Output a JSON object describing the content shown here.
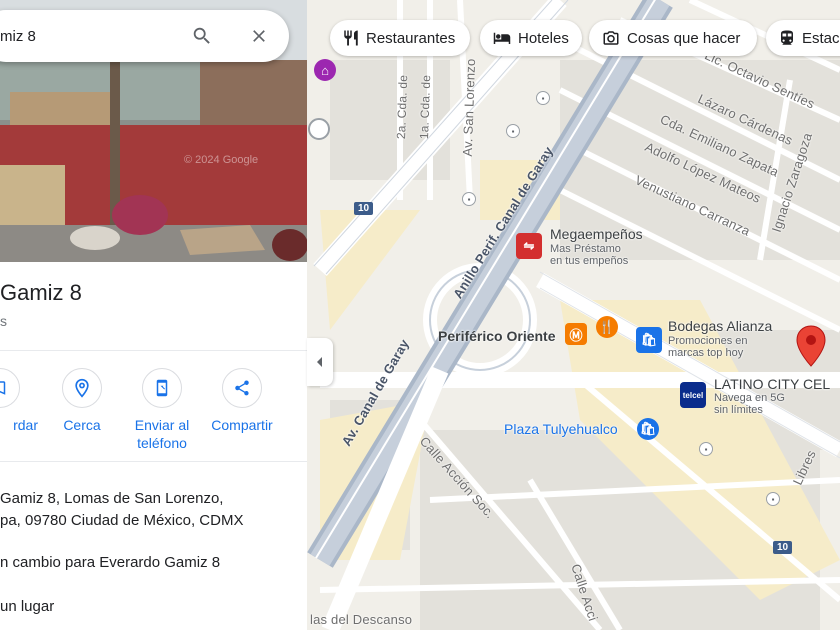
{
  "search": {
    "query": "miz 8"
  },
  "place": {
    "title": "Gamiz 8",
    "subtitle": "s",
    "address_line1": "Gamiz 8, Lomas de San Lorenzo,",
    "address_line2": "pa, 09780 Ciudad de México, CDMX",
    "suggest_edit": "n cambio para Everardo Gamiz 8",
    "add_place": "un lugar",
    "photo_watermark": "© 2024 Google"
  },
  "actions": [
    {
      "label": "rdar",
      "icon": "bookmark-icon"
    },
    {
      "label": "Cerca",
      "icon": "nearby-icon"
    },
    {
      "label": "Enviar al teléfono",
      "icon": "send-to-phone-icon"
    },
    {
      "label": "Compartir",
      "icon": "share-icon"
    }
  ],
  "chips": [
    {
      "label": "Restaurantes",
      "icon": "restaurant-icon"
    },
    {
      "label": "Hoteles",
      "icon": "hotel-icon"
    },
    {
      "label": "Cosas que hacer",
      "icon": "camera-icon"
    },
    {
      "label": "Estac",
      "icon": "transit-icon"
    }
  ],
  "map": {
    "streets": {
      "octavio": "Lic. Octavio Sentíes",
      "lazaro": "Lázaro Cárdenas",
      "emiliano": "Cda. Emiliano Zapata",
      "adolfo": "Adolfo López Mateos",
      "venustiano": "Venustiano Carranza",
      "ignacio": "Ignacio Zaragoza",
      "anillo": "Anillo Perif. Canal de Garay",
      "canal": "Av. Canal de Garay",
      "sanlorenzo": "Av. San Lorenzo",
      "cda2": "2a. Cda. de",
      "cda1": "1a. Cda. de",
      "calleaccion": "Calle Acción Soc.",
      "calleaccion2": "Calle Acci",
      "libres": "Libres",
      "descanso": "las del Descanso"
    },
    "route": "10",
    "pois": {
      "mega_name": "Megaempeños",
      "mega_sub1": "Mas Préstamo",
      "mega_sub2": "en tus empeños",
      "periferico": "Periférico Oriente",
      "bodegas_name": "Bodegas Alianza",
      "bodegas_sub1": "Promociones en",
      "bodegas_sub2": "marcas top hoy",
      "latino_name": "LATINO CITY CEL",
      "latino_sub1": "Navega en 5G",
      "latino_sub2": "sin límites",
      "plaza": "Plaza Tulyehualco",
      "telcel": "telcel"
    }
  },
  "colors": {
    "accent": "#1a73e8",
    "pin": "#ea4335",
    "megaempenos": "#d32f2f",
    "bodegas": "#1a73e8",
    "metro": "#f57c00"
  }
}
